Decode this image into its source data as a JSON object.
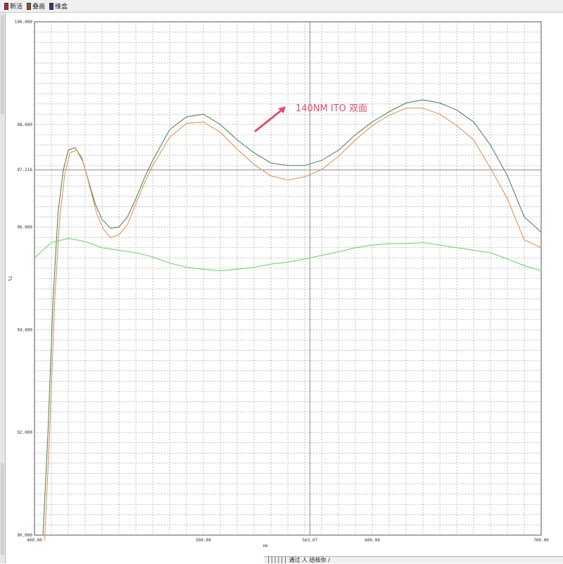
{
  "toolbar": {
    "items": [
      {
        "label": "新活",
        "icon": "document-icon",
        "color": "#b03030"
      },
      {
        "label": "叠画",
        "icon": "overlay-icon",
        "color": "#8a5a20"
      },
      {
        "label": "维盒",
        "icon": "box-icon",
        "color": "#403080"
      }
    ]
  },
  "status_tabs": "││││││ 通过 人 结核你 /",
  "chart_data": {
    "type": "line",
    "xlabel": "nm",
    "ylabel": "T%",
    "xlim": [
      400,
      700
    ],
    "ylim": [
      90,
      100
    ],
    "grid": true,
    "x_ticks": [
      "400.00",
      "500.00",
      "563.07",
      "600.00",
      "700.00"
    ],
    "y_ticks": [
      "90.000",
      "92.000",
      "94.000",
      "96.000",
      "97.116",
      "98.000",
      "100.000"
    ],
    "cursor": {
      "x": 563.07,
      "y": 97.116
    },
    "annotation": "140NM ITO 双面",
    "annotation_color": "#e0506a",
    "series": [
      {
        "color": "#4f8a5f",
        "x": [
          405,
          408,
          411,
          414,
          417,
          420,
          424,
          428,
          432,
          436,
          440,
          445,
          450,
          455,
          460,
          465,
          470,
          480,
          490,
          500,
          510,
          520,
          530,
          540,
          550,
          560,
          570,
          580,
          590,
          600,
          610,
          620,
          630,
          640,
          650,
          660,
          670,
          680,
          690,
          700
        ],
        "y": [
          90.0,
          92.0,
          94.6,
          96.3,
          97.1,
          97.5,
          97.55,
          97.35,
          96.9,
          96.45,
          96.15,
          95.98,
          96.0,
          96.2,
          96.55,
          96.95,
          97.3,
          97.9,
          98.15,
          98.2,
          98.0,
          97.7,
          97.45,
          97.25,
          97.2,
          97.2,
          97.3,
          97.5,
          97.8,
          98.05,
          98.25,
          98.42,
          98.48,
          98.42,
          98.28,
          98.05,
          97.6,
          97.0,
          96.2,
          95.9
        ]
      },
      {
        "color": "#e3954e",
        "x": [
          406,
          409,
          412,
          415,
          418,
          421,
          425,
          429,
          433,
          437,
          441,
          445,
          450,
          455,
          460,
          465,
          470,
          480,
          490,
          500,
          510,
          520,
          530,
          540,
          550,
          560,
          570,
          580,
          590,
          600,
          610,
          620,
          630,
          640,
          650,
          660,
          670,
          680,
          690,
          700
        ],
        "y": [
          89.9,
          92.0,
          94.6,
          96.2,
          97.05,
          97.45,
          97.5,
          97.25,
          96.75,
          96.25,
          95.95,
          95.8,
          95.85,
          96.05,
          96.45,
          96.85,
          97.2,
          97.75,
          98.02,
          98.05,
          97.85,
          97.52,
          97.22,
          97.0,
          96.92,
          96.98,
          97.12,
          97.38,
          97.7,
          97.98,
          98.18,
          98.32,
          98.32,
          98.2,
          97.98,
          97.7,
          97.15,
          96.55,
          95.75,
          95.6
        ]
      },
      {
        "color": "#6fd56f",
        "x": [
          400,
          410,
          420,
          430,
          440,
          450,
          460,
          470,
          480,
          490,
          500,
          510,
          520,
          530,
          540,
          550,
          560,
          570,
          580,
          590,
          600,
          610,
          620,
          630,
          640,
          650,
          660,
          670,
          680,
          690,
          700
        ],
        "y": [
          95.4,
          95.7,
          95.78,
          95.72,
          95.6,
          95.55,
          95.5,
          95.42,
          95.3,
          95.22,
          95.18,
          95.15,
          95.18,
          95.22,
          95.28,
          95.32,
          95.38,
          95.45,
          95.52,
          95.6,
          95.65,
          95.68,
          95.68,
          95.7,
          95.65,
          95.6,
          95.55,
          95.5,
          95.38,
          95.25,
          95.15
        ]
      }
    ]
  }
}
